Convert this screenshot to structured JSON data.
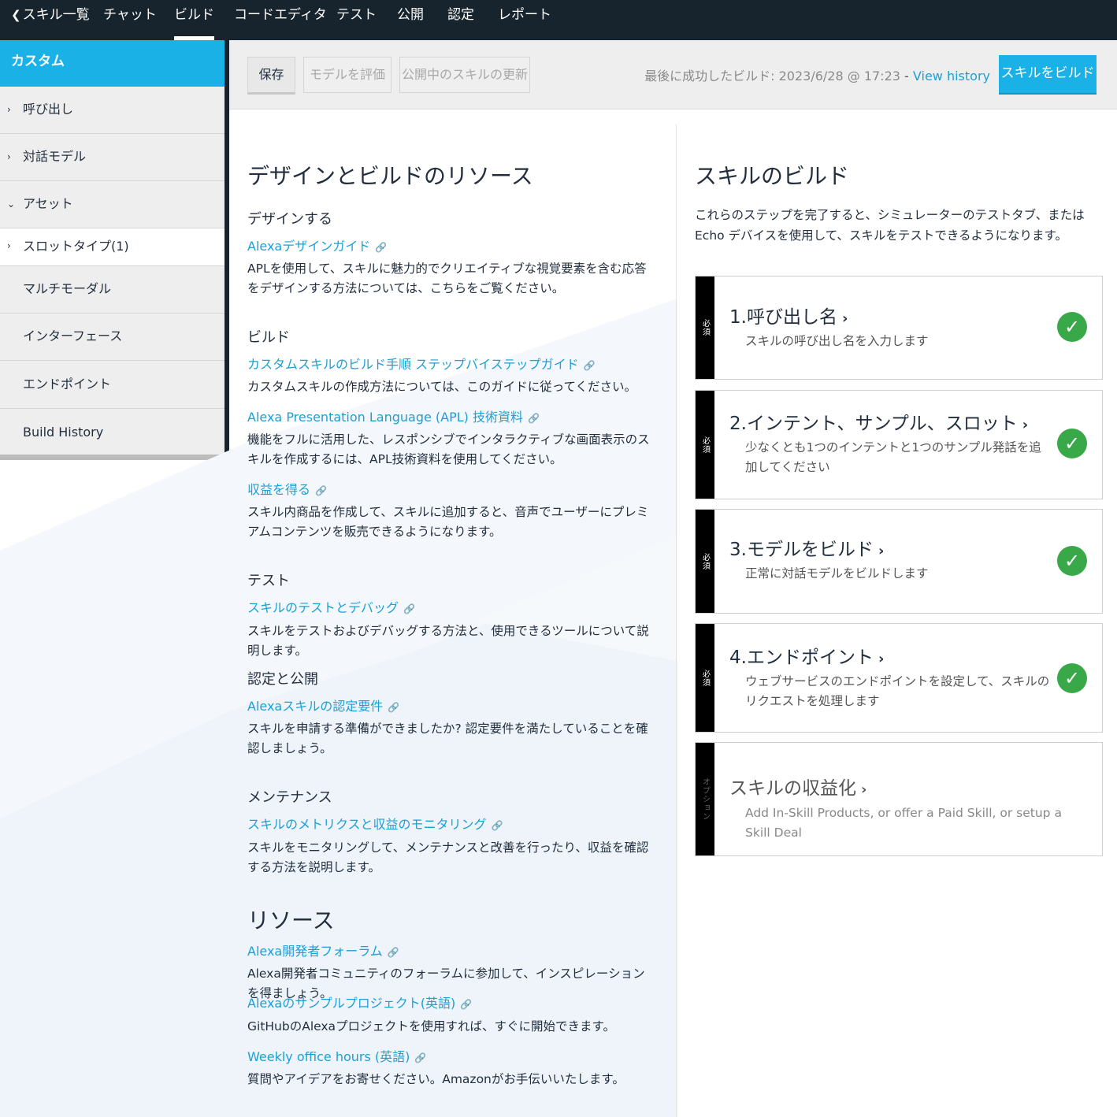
{
  "topnav": {
    "back": "スキル一覧",
    "tabs": [
      "チャット",
      "ビルド",
      "コードエディタ",
      "テスト",
      "公開",
      "認定",
      "レポート"
    ],
    "active": "ビルド"
  },
  "sidebar": {
    "header": "カスタム",
    "items": [
      {
        "label": "呼び出し",
        "chevron": "›"
      },
      {
        "label": "対話モデル",
        "chevron": "›"
      },
      {
        "label": "アセット",
        "chevron": "⌄"
      },
      {
        "label": "スロットタイプ(1)",
        "chevron": "›"
      },
      {
        "label": "マルチモーダル"
      },
      {
        "label": "インターフェース"
      },
      {
        "label": "エンドポイント"
      },
      {
        "label": "Build History"
      }
    ]
  },
  "toolbar": {
    "save": "保存",
    "evaluate": "モデルを評価",
    "update_published": "公開中のスキルの更新",
    "last_build": "最後に成功したビルド: 2023/6/28 @ 17:23",
    "separator": "-",
    "view_history": "View history",
    "build": "スキルをビルド"
  },
  "resources": {
    "title": "デザインとビルドのリソース",
    "design": {
      "heading": "デザインする",
      "link": "Alexaデザインガイド",
      "desc": "APLを使用して、スキルに魅力的でクリエイティブな視覚要素を含む応答をデザインする方法については、こちらをご覧ください。"
    },
    "build": {
      "heading": "ビルド",
      "link1": "カスタムスキルのビルド手順 ステップバイステップガイド",
      "desc1": "カスタムスキルの作成方法については、このガイドに従ってください。",
      "link2": "Alexa Presentation Language (APL) 技術資料",
      "desc2": "機能をフルに活用した、レスポンシブでインタラクティブな画面表示のスキルを作成するには、APL技術資料を使用してください。",
      "link3": "収益を得る",
      "desc3": "スキル内商品を作成して、スキルに追加すると、音声でユーザーにプレミアムコンテンツを販売できるようになります。"
    },
    "test": {
      "heading": "テスト",
      "link": "スキルのテストとデバッグ",
      "desc": "スキルをテストおよびデバッグする方法と、使用できるツールについて説明します。"
    },
    "cert": {
      "heading": "認定と公開",
      "link": "Alexaスキルの認定要件",
      "desc": "スキルを申請する準備ができましたか? 認定要件を満たしていることを確認しましょう。"
    },
    "maint": {
      "heading": "メンテナンス",
      "link": "スキルのメトリクスと収益のモニタリング",
      "desc": "スキルをモニタリングして、メンテナンスと改善を行ったり、収益を確認する方法を説明します。"
    },
    "res": {
      "title": "リソース",
      "link1": "Alexa開発者フォーラム",
      "desc1": "Alexa開発者コミュニティのフォーラムに参加して、インスピレーションを得ましょう。",
      "link2": "Alexaのサンプルプロジェクト(英語)",
      "desc2": "GitHubのAlexaプロジェクトを使用すれば、すぐに開始できます。",
      "link3": "Weekly office hours (英語)",
      "desc3": "質問やアイデアをお寄せください。Amazonがお手伝いいたします。"
    }
  },
  "skill_build": {
    "title": "スキルのビルド",
    "intro": "これらのステップを完了すると、シミュレーターのテストタブ、またはEcho デバイスを使用して、スキルをテストできるようになります。",
    "steps": [
      {
        "tag": "必須",
        "title": "1.呼び出し名",
        "desc": "スキルの呼び出し名を入力します",
        "done": true
      },
      {
        "tag": "必須",
        "title": "2.インテント、サンプル、スロット",
        "desc": "少なくとも1つのインテントと1つのサンプル発話を追加してください",
        "done": true
      },
      {
        "tag": "必須",
        "title": "3.モデルをビルド",
        "desc": "正常に対話モデルをビルドします",
        "done": true
      },
      {
        "tag": "必須",
        "title": "4.エンドポイント",
        "desc": "ウェブサービスのエンドポイントを設定して、スキルのリクエストを処理します",
        "done": true
      },
      {
        "tag": "オプション",
        "title": "スキルの収益化",
        "desc": "Add In-Skill Products, or offer a Paid Skill, or setup a Skill Deal",
        "done": false
      }
    ],
    "chevron": "›",
    "check": "✓"
  },
  "colors": {
    "nav_bg": "#17242e",
    "accent": "#1ab1e6",
    "link": "#1a9fd6",
    "success": "#39a849"
  }
}
